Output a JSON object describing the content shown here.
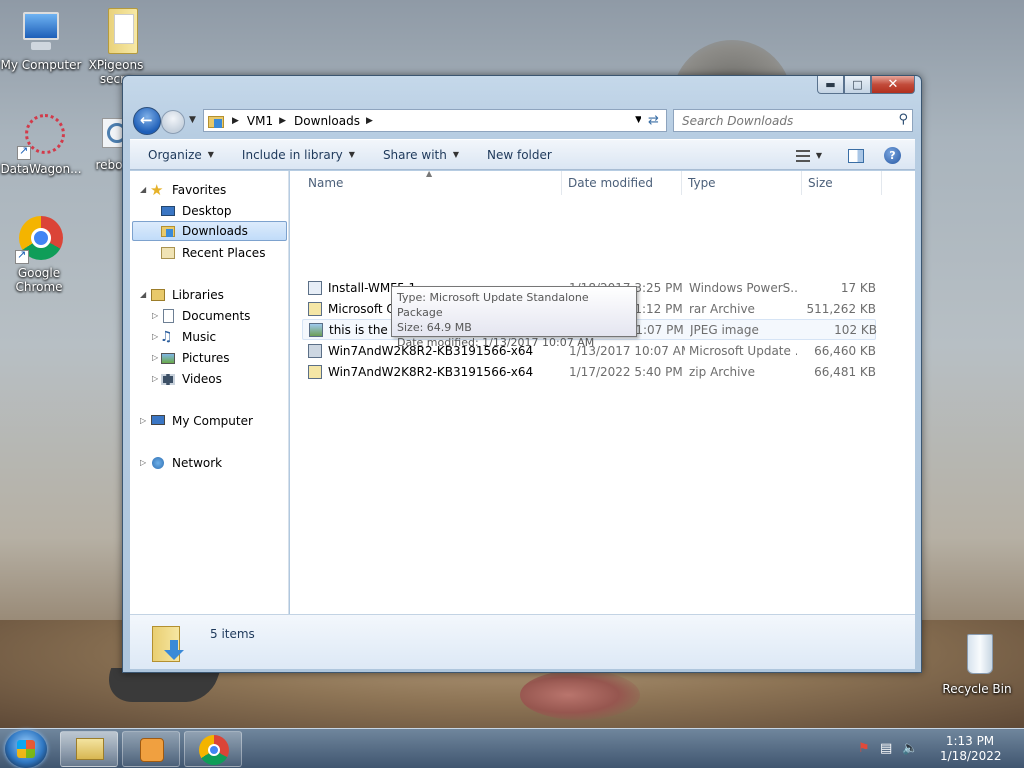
{
  "desktop": {
    "icons": [
      {
        "label": "My Computer"
      },
      {
        "label": "XPigeons secre"
      },
      {
        "label": "DataWagon..."
      },
      {
        "label": "rebo"
      },
      {
        "label": "Google Chrome"
      },
      {
        "label": "Recycle Bin"
      }
    ]
  },
  "window": {
    "breadcrumb": [
      "VM1",
      "Downloads"
    ],
    "search_placeholder": "Search Downloads",
    "toolbar": {
      "organize": "Organize",
      "include_in_library": "Include in library",
      "share_with": "Share with",
      "new_folder": "New folder"
    },
    "nav": {
      "favorites": "Favorites",
      "desktop": "Desktop",
      "downloads": "Downloads",
      "recent_places": "Recent Places",
      "libraries": "Libraries",
      "documents": "Documents",
      "music": "Music",
      "pictures": "Pictures",
      "videos": "Videos",
      "my_computer": "My Computer",
      "network": "Network"
    },
    "columns": {
      "name": "Name",
      "date": "Date modified",
      "type": "Type",
      "size": "Size"
    },
    "files": [
      {
        "name": "Install-WMF5.1",
        "date": "1/18/2017 3:25 PM",
        "type": "Windows PowerS...",
        "size": "17 KB"
      },
      {
        "name": "Microsoft Office 2007 - www.MySoftware...",
        "date": "1/18/2022 1:12 PM",
        "type": "rar Archive",
        "size": "511,262 KB"
      },
      {
        "name": "this is the wallpaper for this vm now",
        "date": "1/18/2022 1:07 PM",
        "type": "JPEG image",
        "size": "102 KB"
      },
      {
        "name": "Win7AndW2K8R2-KB3191566-x64",
        "date": "1/13/2017 10:07 AM",
        "type": "Microsoft Update ...",
        "size": "66,460 KB"
      },
      {
        "name": "Win7AndW2K8R2-KB3191566-x64",
        "date": "1/17/2022 5:40 PM",
        "type": "zip Archive",
        "size": "66,481 KB"
      }
    ],
    "tooltip": {
      "type_line": "Type: Microsoft Update Standalone Package",
      "size_line": "Size: 64.9 MB",
      "date_line": "Date modified: 1/13/2017 10:07 AM"
    },
    "details": {
      "count": "5 items"
    }
  },
  "taskbar": {
    "time": "1:13 PM",
    "date": "1/18/2022"
  }
}
